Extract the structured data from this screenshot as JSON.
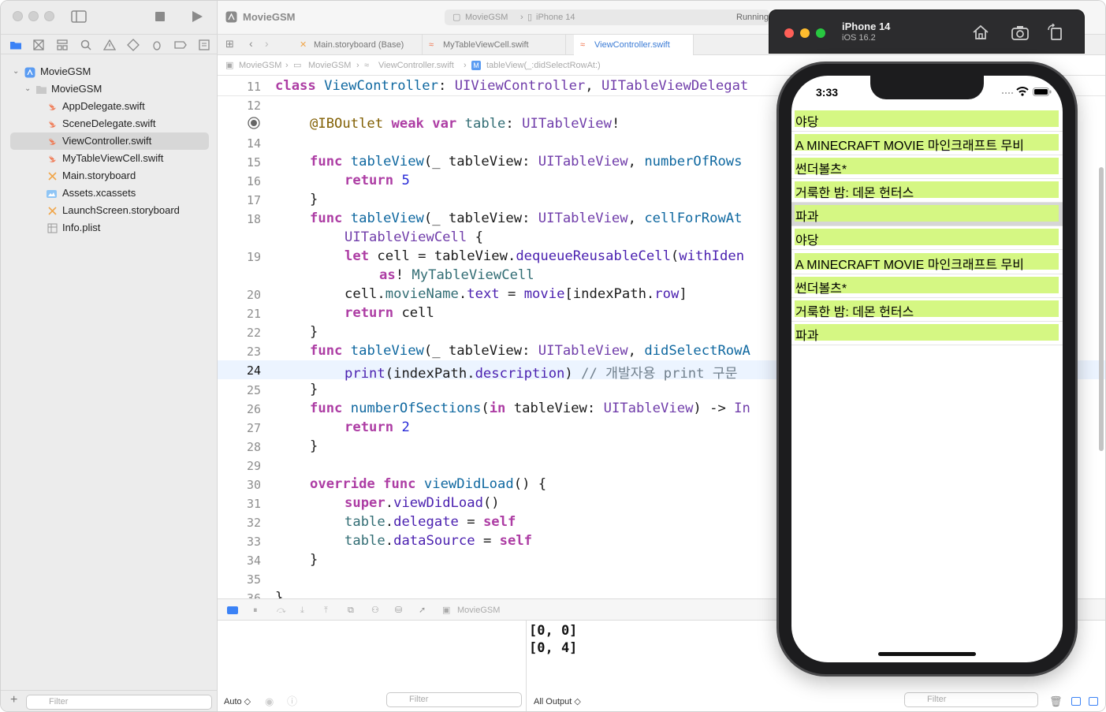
{
  "project": {
    "name": "MovieGSM",
    "group": "MovieGSM",
    "files": [
      "AppDelegate.swift",
      "SceneDelegate.swift",
      "ViewController.swift",
      "MyTableViewCell.swift",
      "Main.storyboard",
      "Assets.xcassets",
      "LaunchScreen.storyboard",
      "Info.plist"
    ],
    "selected_file": "ViewController.swift",
    "filter_placeholder": "Filter"
  },
  "toolbar": {
    "scheme": "MovieGSM",
    "destination": "iPhone 14",
    "status": "Running"
  },
  "tabs": [
    "Main.storyboard (Base)",
    "MyTableViewCell.swift",
    "ViewController.swift"
  ],
  "jump_bar": [
    "MovieGSM",
    "MovieGSM",
    "ViewController.swift",
    "tableView(_:didSelectRowAt:)"
  ],
  "editor": {
    "current_line": "24",
    "line_numbers": [
      "11",
      "12",
      "",
      "14",
      "15",
      "16",
      "17",
      "18",
      "",
      "19",
      "",
      "20",
      "21",
      "22",
      "23",
      "24",
      "25",
      "26",
      "27",
      "28",
      "29",
      "30",
      "31",
      "32",
      "33",
      "34",
      "35",
      "36"
    ],
    "sticky_header": {
      "kw": "class",
      "name": "ViewController",
      "sep1": ":",
      "t1": "UIViewController",
      "sep2": ",",
      "t2": "UITableViewDelegat"
    },
    "code": {
      "l13": {
        "attr": "@IBOutlet",
        "kw": "weak var",
        "name": "table",
        "colon": ":",
        "type": "UITableView",
        "bang": "!"
      },
      "l15": {
        "kw": "func",
        "fn": "tableView",
        "args": "(_ tableView: ",
        "type": "UITableView",
        "comma": ", ",
        "label": "numberOfRows"
      },
      "l16": {
        "kw": "return",
        "num": "5"
      },
      "l17": "}",
      "l18": {
        "kw": "func",
        "fn": "tableView",
        "args": "(_ tableView: ",
        "type": "UITableView",
        "comma": ", ",
        "label": "cellForRowAt"
      },
      "l18b": {
        "type": "UITableViewCell",
        "rest": " {"
      },
      "l19": {
        "kw": "let",
        "rest1": " cell = tableView.",
        "fn": "dequeueReusableCell",
        "rest2": "(",
        "label": "withIden"
      },
      "l19b": {
        "kw": "as",
        "bang": "! ",
        "type": "MyTableViewCell"
      },
      "l20": {
        "a": "cell.",
        "p1": "movieName",
        "b": ".",
        "p2": "text",
        "c": " = ",
        "p3": "movie",
        "d": "[indexPath.",
        "p4": "row",
        "e": "]"
      },
      "l21": {
        "kw": "return",
        "rest": " cell"
      },
      "l22": "}",
      "l23": {
        "kw": "func",
        "fn": "tableView",
        "args": "(_ tableView: ",
        "type": "UITableView",
        "comma": ", ",
        "label": "didSelectRowA"
      },
      "l24": {
        "fn": "print",
        "a": "(indexPath.",
        "p": "description",
        "b": ") ",
        "comment": "// 개발자용 print 구문"
      },
      "l25": "}",
      "l26": {
        "kw": "func",
        "fn": "numberOfSections",
        "a": "(",
        "kw2": "in",
        "b": " tableView: ",
        "type": "UITableView",
        "c": ") -> ",
        "t2": "In"
      },
      "l27": {
        "kw": "return",
        "num": "2"
      },
      "l28": "}",
      "l30": {
        "kw": "override func",
        "fn": "viewDidLoad",
        "rest": "() {"
      },
      "l31": {
        "kw": "super",
        "a": ".",
        "fn": "viewDidLoad",
        "b": "()"
      },
      "l32": {
        "p1": "table",
        "a": ".",
        "p2": "delegate",
        "b": " = ",
        "kw": "self"
      },
      "l33": {
        "p1": "table",
        "a": ".",
        "p2": "dataSource",
        "b": " = ",
        "kw": "self"
      },
      "l34": "}",
      "l36": "}"
    }
  },
  "debug": {
    "target": "MovieGSM",
    "console_lines": [
      "[0, 0]",
      "[0, 4]"
    ],
    "auto_label": "Auto ◇",
    "all_output_label": "All Output ◇",
    "filter_placeholder": "Filter"
  },
  "simulator": {
    "device": "iPhone 14",
    "os": "iOS 16.2",
    "time": "3:33",
    "rows": [
      "야당",
      "A MINECRAFT MOVIE 마인크래프트 무비",
      "썬더볼츠*",
      "거룩한 밤: 데몬 헌터스",
      "파과",
      "야당",
      "A MINECRAFT MOVIE 마인크래프트 무비",
      "썬더볼츠*",
      "거룩한 밤: 데몬 헌터스",
      "파과"
    ],
    "selected_row_index": 4,
    "cell_color": "#d5f783"
  }
}
